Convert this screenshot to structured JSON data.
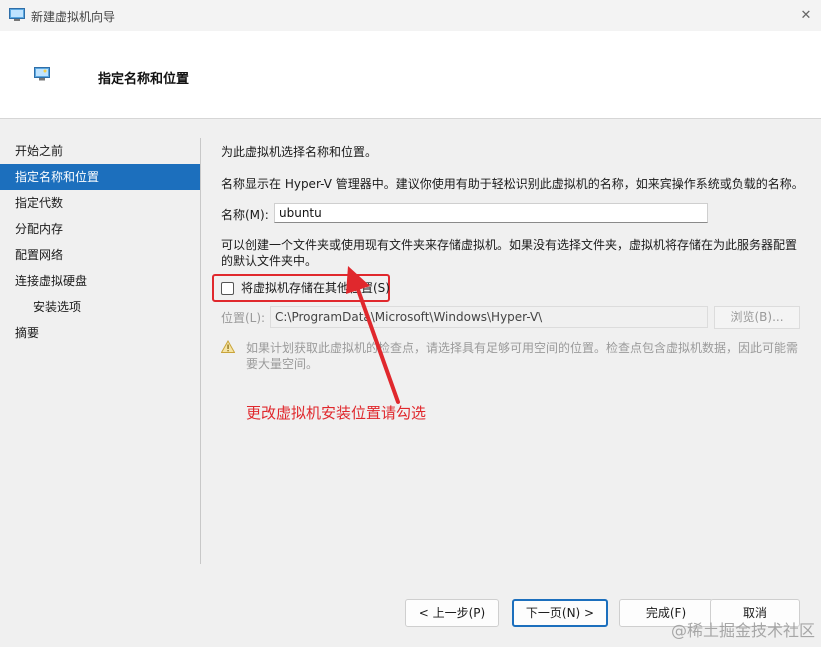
{
  "window": {
    "title": "新建虚拟机向导",
    "close_glyph": "✕"
  },
  "header": {
    "title": "指定名称和位置"
  },
  "sidebar": {
    "items": [
      {
        "label": "开始之前"
      },
      {
        "label": "指定名称和位置"
      },
      {
        "label": "指定代数"
      },
      {
        "label": "分配内存"
      },
      {
        "label": "配置网络"
      },
      {
        "label": "连接虚拟硬盘"
      },
      {
        "label": "安装选项"
      },
      {
        "label": "摘要"
      }
    ]
  },
  "main": {
    "intro": "为此虚拟机选择名称和位置。",
    "name_hint": "名称显示在 Hyper-V 管理器中。建议你使用有助于轻松识别此虚拟机的名称，如来宾操作系统或负载的名称。",
    "name_label": "名称(M):",
    "name_value": "ubuntu",
    "folder_hint": "可以创建一个文件夹或使用现有文件夹来存储虚拟机。如果没有选择文件夹，虚拟机将存储在为此服务器配置的默认文件夹中。",
    "store_checkbox_label": "将虚拟机存储在其他位置(S)",
    "location_label": "位置(L):",
    "location_value": "C:\\ProgramData\\Microsoft\\Windows\\Hyper-V\\",
    "browse_label": "浏览(B)...",
    "warning_text": "如果计划获取此虚拟机的检查点，请选择具有足够可用空间的位置。检查点包含虚拟机数据，因此可能需要大量空间。"
  },
  "annotation": {
    "text": "更改虚拟机安装位置请勾选",
    "color": "#e0282d"
  },
  "buttons": {
    "prev": "< 上一步(P)",
    "next": "下一页(N) >",
    "finish": "完成(F)",
    "cancel": "取消"
  },
  "watermark": "@稀土掘金技术社区",
  "colors": {
    "accent": "#1c6fbd",
    "annotation_red": "#e0282d"
  }
}
